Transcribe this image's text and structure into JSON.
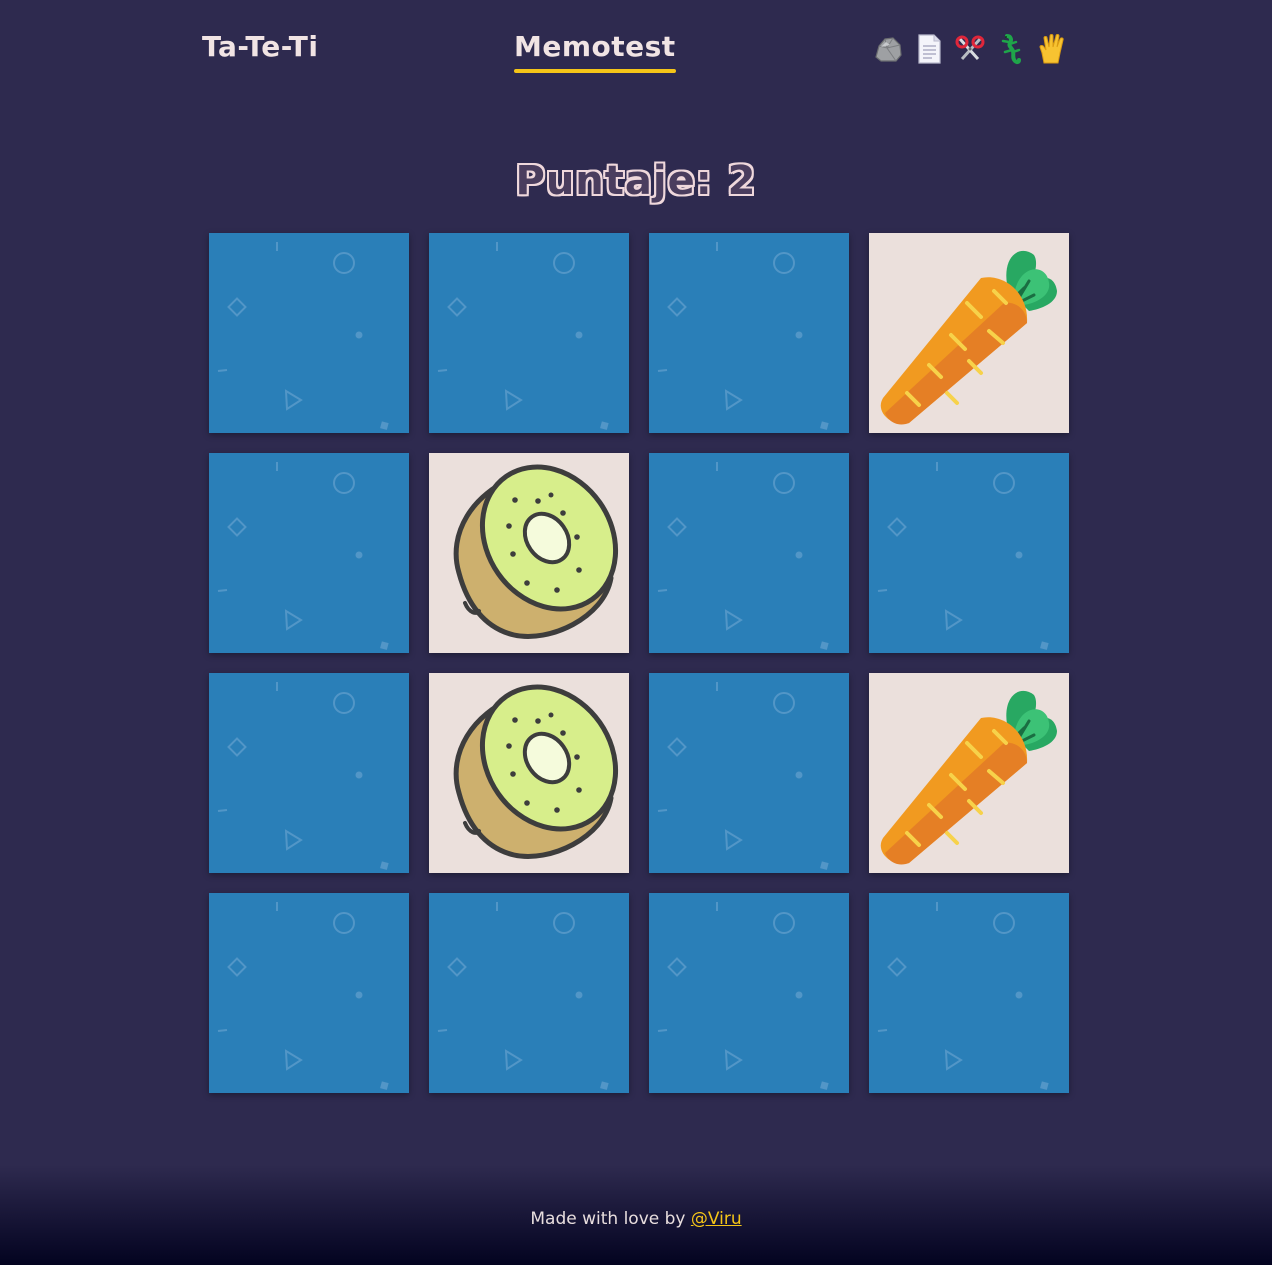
{
  "nav": {
    "tateti_label": "Ta-Te-Ti",
    "memotest_label": "Memotest",
    "active_color": "#f5c518",
    "rps_icons": [
      "rock-icon",
      "paper-icon",
      "scissors-icon",
      "lizard-icon",
      "spock-icon"
    ]
  },
  "score": {
    "text": "Puntaje: 2"
  },
  "board": {
    "columns": 4,
    "rows": 4,
    "back_color": "#2a7fb8",
    "front_color": "#ebe0dc",
    "cards": [
      "hidden",
      "hidden",
      "hidden",
      "carrot",
      "hidden",
      "kiwi",
      "hidden",
      "hidden",
      "hidden",
      "kiwi",
      "hidden",
      "carrot",
      "hidden",
      "hidden",
      "hidden",
      "hidden"
    ]
  },
  "footer": {
    "text": "Made with love by",
    "link_text": "@Viru",
    "link_color": "#f5c518"
  },
  "colors": {
    "background": "#2e2a4f",
    "text": "#f1e4e4"
  }
}
